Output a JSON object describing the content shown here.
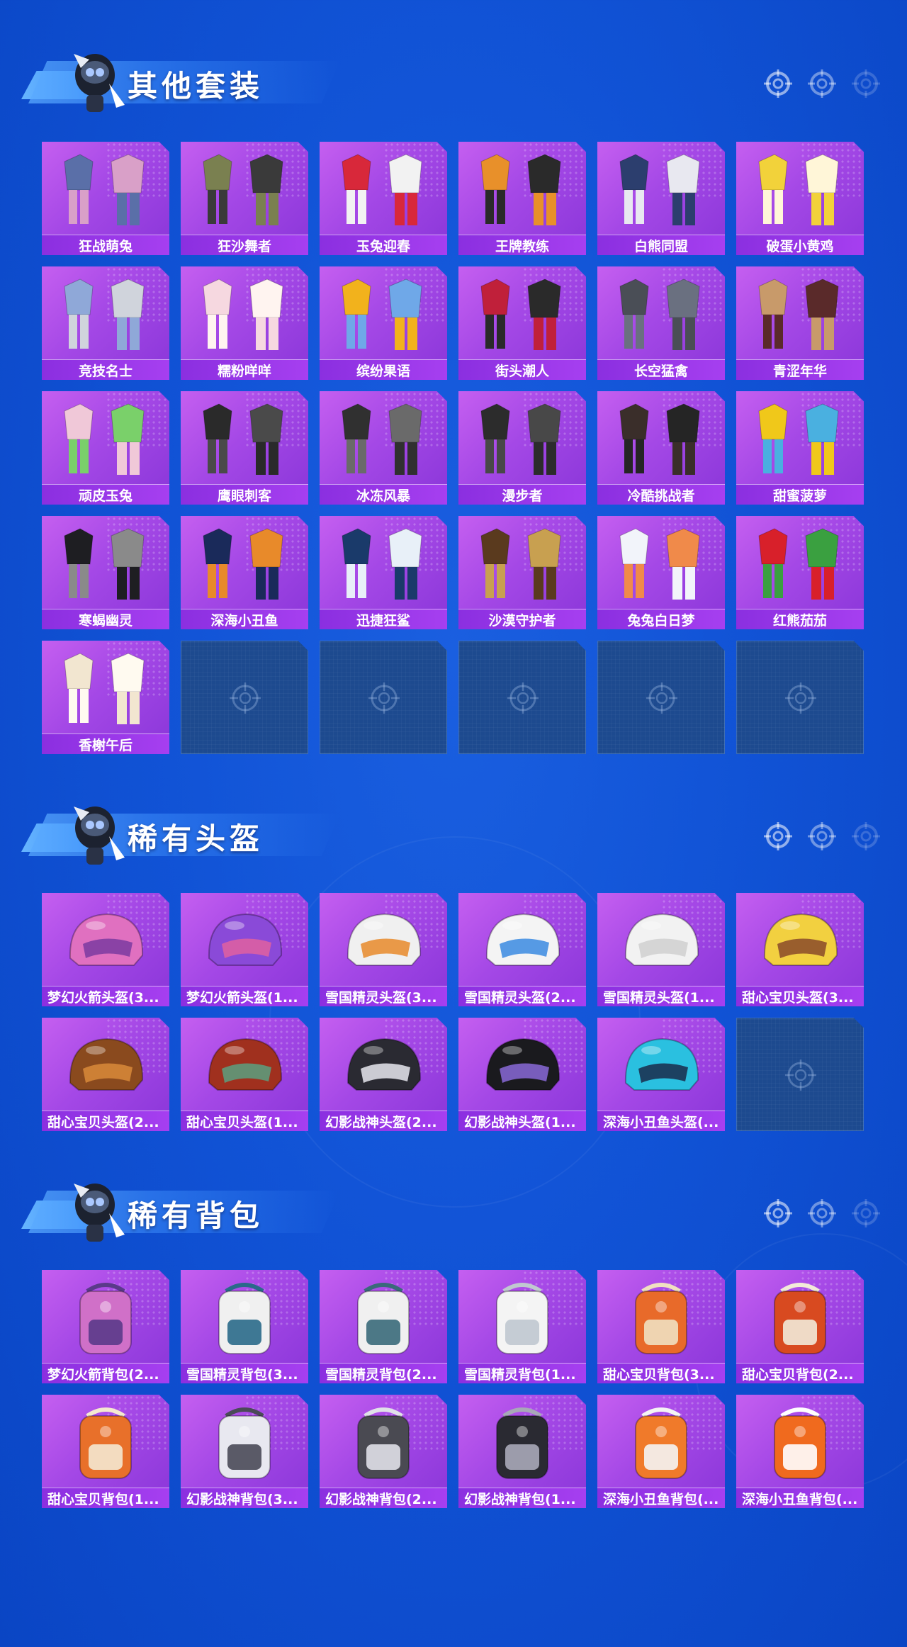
{
  "sections": [
    {
      "title": "其他套装",
      "items": [
        {
          "label": "狂战萌兔",
          "kind": "outfit",
          "c1": "#5a6fa8",
          "c2": "#d9a0c8"
        },
        {
          "label": "狂沙舞者",
          "kind": "outfit",
          "c1": "#7a8050",
          "c2": "#3a3a3a"
        },
        {
          "label": "玉兔迎春",
          "kind": "outfit",
          "c1": "#d8283a",
          "c2": "#f2f2f2"
        },
        {
          "label": "王牌教练",
          "kind": "outfit",
          "c1": "#e8902a",
          "c2": "#2a2a2a"
        },
        {
          "label": "白熊同盟",
          "kind": "outfit",
          "c1": "#2c3e6e",
          "c2": "#e8e8f0"
        },
        {
          "label": "破蛋小黄鸡",
          "kind": "outfit",
          "c1": "#f2d23a",
          "c2": "#fff6d8"
        },
        {
          "label": "竞技名士",
          "kind": "outfit",
          "c1": "#8fa8d8",
          "c2": "#d0d4dc"
        },
        {
          "label": "糯粉咩咩",
          "kind": "outfit",
          "c1": "#f6d8e0",
          "c2": "#fff4f0"
        },
        {
          "label": "缤纷果语",
          "kind": "outfit",
          "c1": "#f2b21c",
          "c2": "#6fa8e8"
        },
        {
          "label": "街头潮人",
          "kind": "outfit",
          "c1": "#c0203a",
          "c2": "#2a2a2a"
        },
        {
          "label": "长空猛禽",
          "kind": "outfit",
          "c1": "#4a4e56",
          "c2": "#6a7080"
        },
        {
          "label": "青涩年华",
          "kind": "outfit",
          "c1": "#c89a6a",
          "c2": "#5a2a2a"
        },
        {
          "label": "顽皮玉兔",
          "kind": "outfit",
          "c1": "#f0c8d8",
          "c2": "#7ad06a"
        },
        {
          "label": "鹰眼刺客",
          "kind": "outfit",
          "c1": "#2a2a2a",
          "c2": "#4a4a4a"
        },
        {
          "label": "冰冻风暴",
          "kind": "outfit",
          "c1": "#303030",
          "c2": "#6a6a6a"
        },
        {
          "label": "漫步者",
          "kind": "outfit",
          "c1": "#2c2c2c",
          "c2": "#484848"
        },
        {
          "label": "冷酷挑战者",
          "kind": "outfit",
          "c1": "#3a2e2a",
          "c2": "#252525"
        },
        {
          "label": "甜蜜菠萝",
          "kind": "outfit",
          "c1": "#f0c81a",
          "c2": "#4ab0e0"
        },
        {
          "label": "寒蝎幽灵",
          "kind": "outfit",
          "c1": "#1e1e22",
          "c2": "#8a8a8a"
        },
        {
          "label": "深海小丑鱼",
          "kind": "outfit",
          "c1": "#1a2a5a",
          "c2": "#e88a2a"
        },
        {
          "label": "迅捷狂鲨",
          "kind": "outfit",
          "c1": "#1a3a6a",
          "c2": "#e8f0f8"
        },
        {
          "label": "沙漠守护者",
          "kind": "outfit",
          "c1": "#5a3a1e",
          "c2": "#c8a050"
        },
        {
          "label": "兔兔白日梦",
          "kind": "outfit",
          "c1": "#f2f4fa",
          "c2": "#f08a4a"
        },
        {
          "label": "红熊茄茄",
          "kind": "outfit",
          "c1": "#d8202a",
          "c2": "#3aa040"
        },
        {
          "label": "香榭午后",
          "kind": "outfit",
          "c1": "#f2e6d0",
          "c2": "#fffaf0"
        },
        {
          "empty": true
        },
        {
          "empty": true
        },
        {
          "empty": true
        },
        {
          "empty": true
        },
        {
          "empty": true
        }
      ]
    },
    {
      "title": "稀有头盔",
      "items": [
        {
          "label": "梦幻火箭头盔(3...",
          "kind": "helmet",
          "c1": "#e070c0",
          "c2": "#7a3aa0"
        },
        {
          "label": "梦幻火箭头盔(1...",
          "kind": "helmet",
          "c1": "#8a4ad8",
          "c2": "#e060a0"
        },
        {
          "label": "雪国精灵头盔(3...",
          "kind": "helmet",
          "c1": "#f0f0f0",
          "c2": "#e88a2a"
        },
        {
          "label": "雪国精灵头盔(2...",
          "kind": "helmet",
          "c1": "#f4f4f4",
          "c2": "#3a8ae0"
        },
        {
          "label": "雪国精灵头盔(1...",
          "kind": "helmet",
          "c1": "#f2f2f2",
          "c2": "#d0d0d0"
        },
        {
          "label": "甜心宝贝头盔(3...",
          "kind": "helmet",
          "c1": "#f2d040",
          "c2": "#8a4a2a"
        },
        {
          "label": "甜心宝贝头盔(2...",
          "kind": "helmet",
          "c1": "#8a4a1e",
          "c2": "#d88a3a"
        },
        {
          "label": "甜心宝贝头盔(1...",
          "kind": "helmet",
          "c1": "#a0301e",
          "c2": "#5aa080"
        },
        {
          "label": "幻影战神头盔(2...",
          "kind": "helmet",
          "c1": "#2a2a32",
          "c2": "#e8e8f0"
        },
        {
          "label": "幻影战神头盔(1...",
          "kind": "helmet",
          "c1": "#1a1a1e",
          "c2": "#8a6ad8"
        },
        {
          "label": "深海小丑鱼头盔(...",
          "kind": "helmet",
          "c1": "#2ac0e0",
          "c2": "#1a2a4a"
        },
        {
          "empty": true
        }
      ]
    },
    {
      "title": "稀有背包",
      "items": [
        {
          "label": "梦幻火箭背包(2...",
          "kind": "backpack",
          "c1": "#d070c8",
          "c2": "#5a3a8a"
        },
        {
          "label": "雪国精灵背包(3...",
          "kind": "backpack",
          "c1": "#f0f0f0",
          "c2": "#2a6a8a"
        },
        {
          "label": "雪国精灵背包(2...",
          "kind": "backpack",
          "c1": "#f0f0f0",
          "c2": "#3a6a7a"
        },
        {
          "label": "雪国精灵背包(1...",
          "kind": "backpack",
          "c1": "#f4f4f4",
          "c2": "#c0c8d0"
        },
        {
          "label": "甜心宝贝背包(3...",
          "kind": "backpack",
          "c1": "#e86a2a",
          "c2": "#f0e0c0"
        },
        {
          "label": "甜心宝贝背包(2...",
          "kind": "backpack",
          "c1": "#d84a20",
          "c2": "#f2ead8"
        },
        {
          "label": "甜心宝贝背包(1...",
          "kind": "backpack",
          "c1": "#e8702a",
          "c2": "#f4e8d0"
        },
        {
          "label": "幻影战神背包(3...",
          "kind": "backpack",
          "c1": "#e8e8f0",
          "c2": "#4a4a58"
        },
        {
          "label": "幻影战神背包(2...",
          "kind": "backpack",
          "c1": "#4a4a52",
          "c2": "#e0e0e8"
        },
        {
          "label": "幻影战神背包(1...",
          "kind": "backpack",
          "c1": "#2a2a32",
          "c2": "#a8a8b8"
        },
        {
          "label": "深海小丑鱼背包(...",
          "kind": "backpack",
          "c1": "#f07a2a",
          "c2": "#f4f4f4"
        },
        {
          "label": "深海小丑鱼背包(...",
          "kind": "backpack",
          "c1": "#f06a1e",
          "c2": "#ffffff"
        }
      ]
    }
  ]
}
